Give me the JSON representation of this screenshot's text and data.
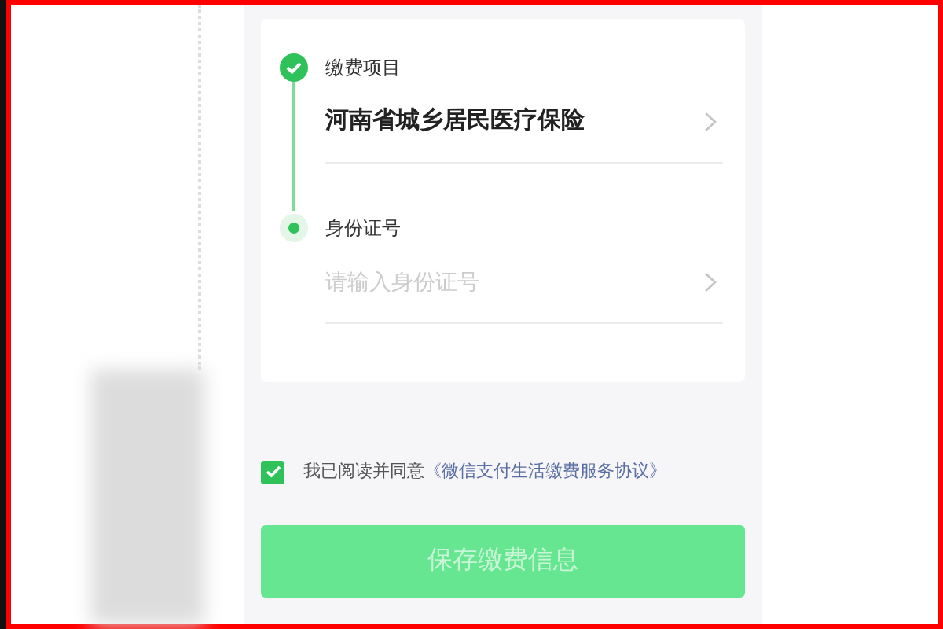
{
  "steps": [
    {
      "label": "缴费项目",
      "done": true,
      "kind": "value",
      "text": "河南省城乡居民医疗保险"
    },
    {
      "label": "身份证号",
      "done": false,
      "kind": "input",
      "placeholder": "请输入身份证号"
    }
  ],
  "agreement": {
    "checked": true,
    "text": "我已阅读并同意",
    "link": "《微信支付生活缴费服务协议》"
  },
  "save_button": {
    "label": "保存缴费信息",
    "disabled": true
  }
}
